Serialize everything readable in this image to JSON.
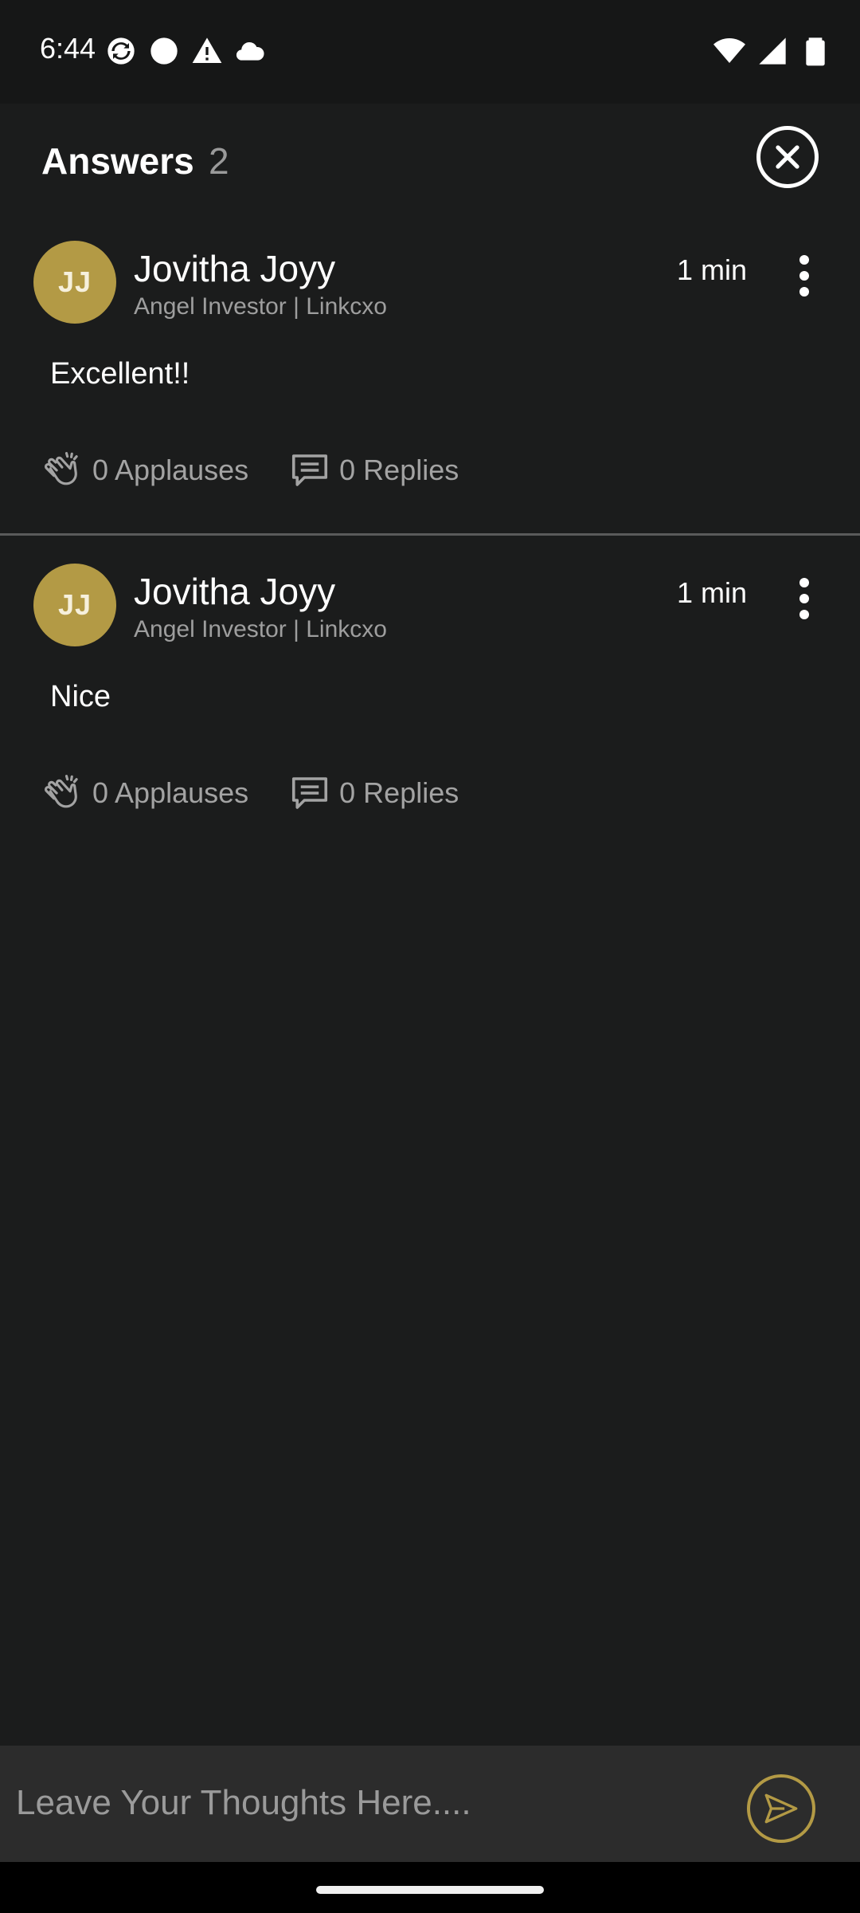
{
  "status_bar": {
    "time": "6:44",
    "left_icons": [
      "sync-icon",
      "circle-icon",
      "warning-icon",
      "cloud-icon"
    ],
    "right_icons": [
      "wifi-icon",
      "signal-icon",
      "battery-icon"
    ]
  },
  "header": {
    "title": "Answers",
    "count": "2"
  },
  "answers": [
    {
      "initials": "JJ",
      "name": "Jovitha Joyy",
      "role": "Angel Investor | Linkcxo",
      "time": "1 min",
      "text": "Excellent!!",
      "applauses": "0 Applauses",
      "replies": "0 Replies"
    },
    {
      "initials": "JJ",
      "name": "Jovitha Joyy",
      "role": "Angel Investor | Linkcxo",
      "time": "1 min",
      "text": "Nice",
      "applauses": "0 Applauses",
      "replies": "0 Replies"
    }
  ],
  "composer": {
    "placeholder": "Leave Your Thoughts Here....",
    "value": ""
  },
  "colors": {
    "background": "#1b1c1c",
    "accent": "#b39a45",
    "muted_text": "#9e9e9e"
  }
}
